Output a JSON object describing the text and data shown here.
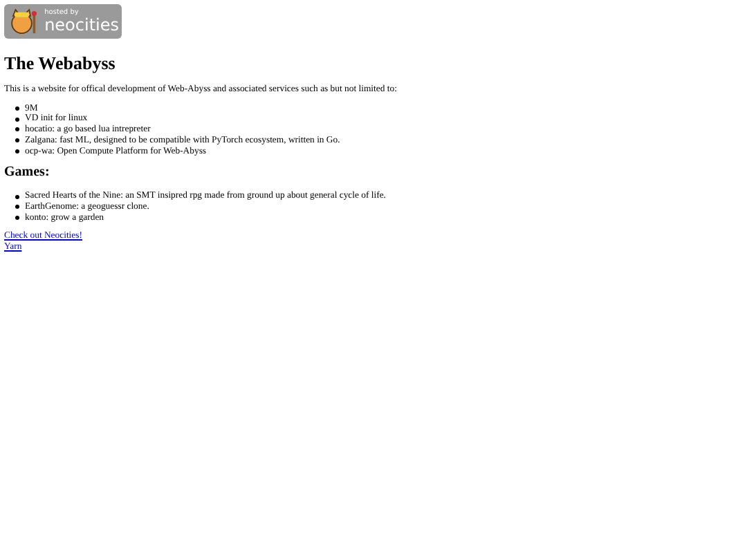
{
  "badge": {
    "small": "hosted by",
    "big": "neocities"
  },
  "title": "The Webabyss",
  "intro": "This is a website for offical development of Web-Abyss and associated services such as but not limited to:",
  "projects": [
    "9M",
    "VD init for linux",
    "hocatio: a go based lua intrepreter",
    "Zalgana: fast ML, designed to be compatible with PyTorch ecosystem, written in Go.",
    "ocp-wa: Open Compute Platform for Web-Abyss"
  ],
  "games_heading": "Games:",
  "games": [
    "Sacred Hearts of the Nine: an SMT insipred rpg made from ground up about general cycle of life.",
    "EarthGenome: a geoguessr clone.",
    "konto: grow a garden"
  ],
  "links": [
    "Check out Neocities!",
    "Yarn"
  ]
}
